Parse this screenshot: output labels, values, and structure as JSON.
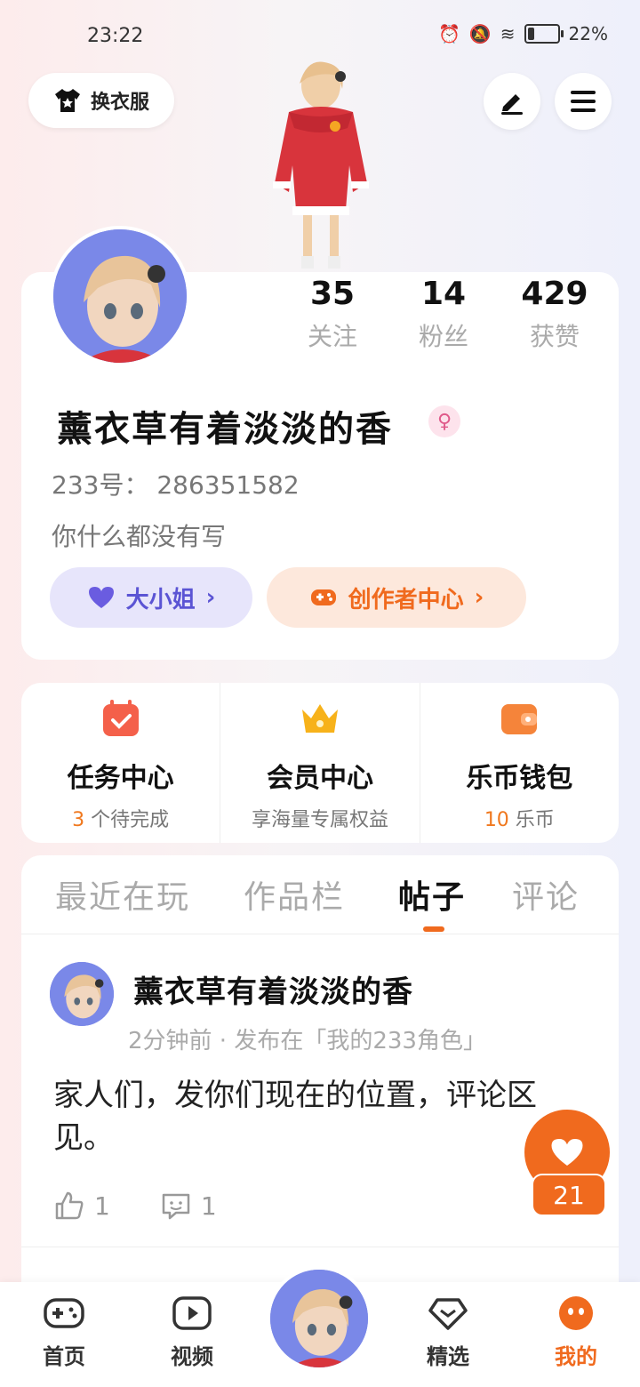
{
  "status_bar": {
    "time": "23:22",
    "battery": "22%",
    "battery_level": 0.22
  },
  "header": {
    "wardrobe_label": "换衣服",
    "edit_icon": "pen-icon",
    "menu_icon": "menu-icon"
  },
  "profile": {
    "stats": [
      {
        "value": "35",
        "label": "关注"
      },
      {
        "value": "14",
        "label": "粉丝"
      },
      {
        "value": "429",
        "label": "获赞"
      }
    ],
    "username": "薰衣草有着淡淡的香",
    "gender_symbol": "♀",
    "uid": "233号： 286351582",
    "bio": "你什么都没有写",
    "tags": [
      {
        "label": "大小姐",
        "icon": "heart-icon"
      },
      {
        "label": "创作者中心",
        "icon": "gamepad-icon"
      }
    ]
  },
  "services": [
    {
      "title": "任务中心",
      "sub_highlight": "3",
      "sub_text": " 个待完成",
      "icon": "calendar-icon",
      "color": "#f4604a"
    },
    {
      "title": "会员中心",
      "sub_highlight": "",
      "sub_text": "享海量专属权益",
      "icon": "crown-icon",
      "color": "#f7b21a"
    },
    {
      "title": "乐币钱包",
      "sub_highlight": "10",
      "sub_text": " 乐币",
      "icon": "wallet-icon",
      "color": "#f5843a"
    }
  ],
  "tabs": [
    "最近在玩",
    "作品栏",
    "帖子",
    "评论"
  ],
  "active_tab": "帖子",
  "post": {
    "author": "薰衣草有着淡淡的香",
    "meta": "2分钟前 · 发布在「我的233角色」",
    "text": "家人们，发你们现在的位置，评论区见。",
    "likes": "1",
    "comments": "1"
  },
  "fab": {
    "count": "21"
  },
  "bottom_nav": [
    {
      "label": "首页",
      "icon": "gamepad-icon"
    },
    {
      "label": "视频",
      "icon": "play-icon"
    },
    {
      "label": "精选",
      "icon": "heart-diamond-icon"
    },
    {
      "label": "我的",
      "icon": "smile-icon"
    }
  ],
  "colors": {
    "accent": "#f06a1e",
    "purple": "#5b54d4"
  }
}
